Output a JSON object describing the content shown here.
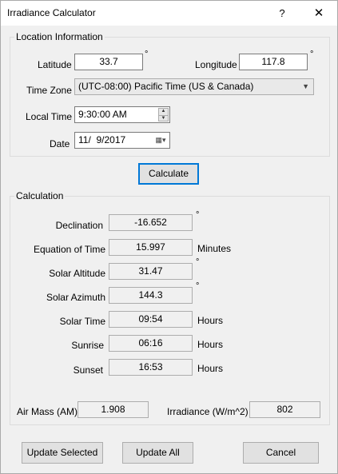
{
  "window": {
    "title": "Irradiance Calculator",
    "help_label": "?",
    "close_label": "✕"
  },
  "location": {
    "group_label": "Location Information",
    "latitude_label": "Latitude",
    "latitude_value": "33.7",
    "longitude_label": "Longitude",
    "longitude_value": "117.8",
    "degree_symbol": "°",
    "timezone_label": "Time Zone",
    "timezone_value": "(UTC-08:00) Pacific Time (US & Canada)",
    "localtime_label": "Local Time",
    "localtime_value": "9:30:00 AM",
    "date_label": "Date",
    "date_value": "11/  9/2017"
  },
  "calculate_button": "Calculate",
  "calculation": {
    "group_label": "Calculation",
    "declination_label": "Declination",
    "declination_value": "-16.652",
    "eot_label": "Equation of Time",
    "eot_value": "15.997",
    "eot_unit": "Minutes",
    "altitude_label": "Solar Altitude",
    "altitude_value": "31.47",
    "azimuth_label": "Solar Azimuth",
    "azimuth_value": "144.3",
    "solartime_label": "Solar Time",
    "solartime_value": "09:54",
    "sunrise_label": "Sunrise",
    "sunrise_value": "06:16",
    "sunset_label": "Sunset",
    "sunset_value": "16:53",
    "hours_unit": "Hours",
    "degree_symbol": "°",
    "airmass_label": "Air Mass (AM)",
    "airmass_value": "1.908",
    "irradiance_label": "Irradiance (W/m^2)",
    "irradiance_value": "802"
  },
  "footer": {
    "update_selected": "Update Selected",
    "update_all": "Update All",
    "cancel": "Cancel"
  },
  "icons": {
    "dropdown": "chevron-down-icon",
    "spin_up": "spin-up-icon",
    "spin_down": "spin-down-icon",
    "calendar": "calendar-icon",
    "close": "close-icon",
    "help": "help-icon"
  }
}
